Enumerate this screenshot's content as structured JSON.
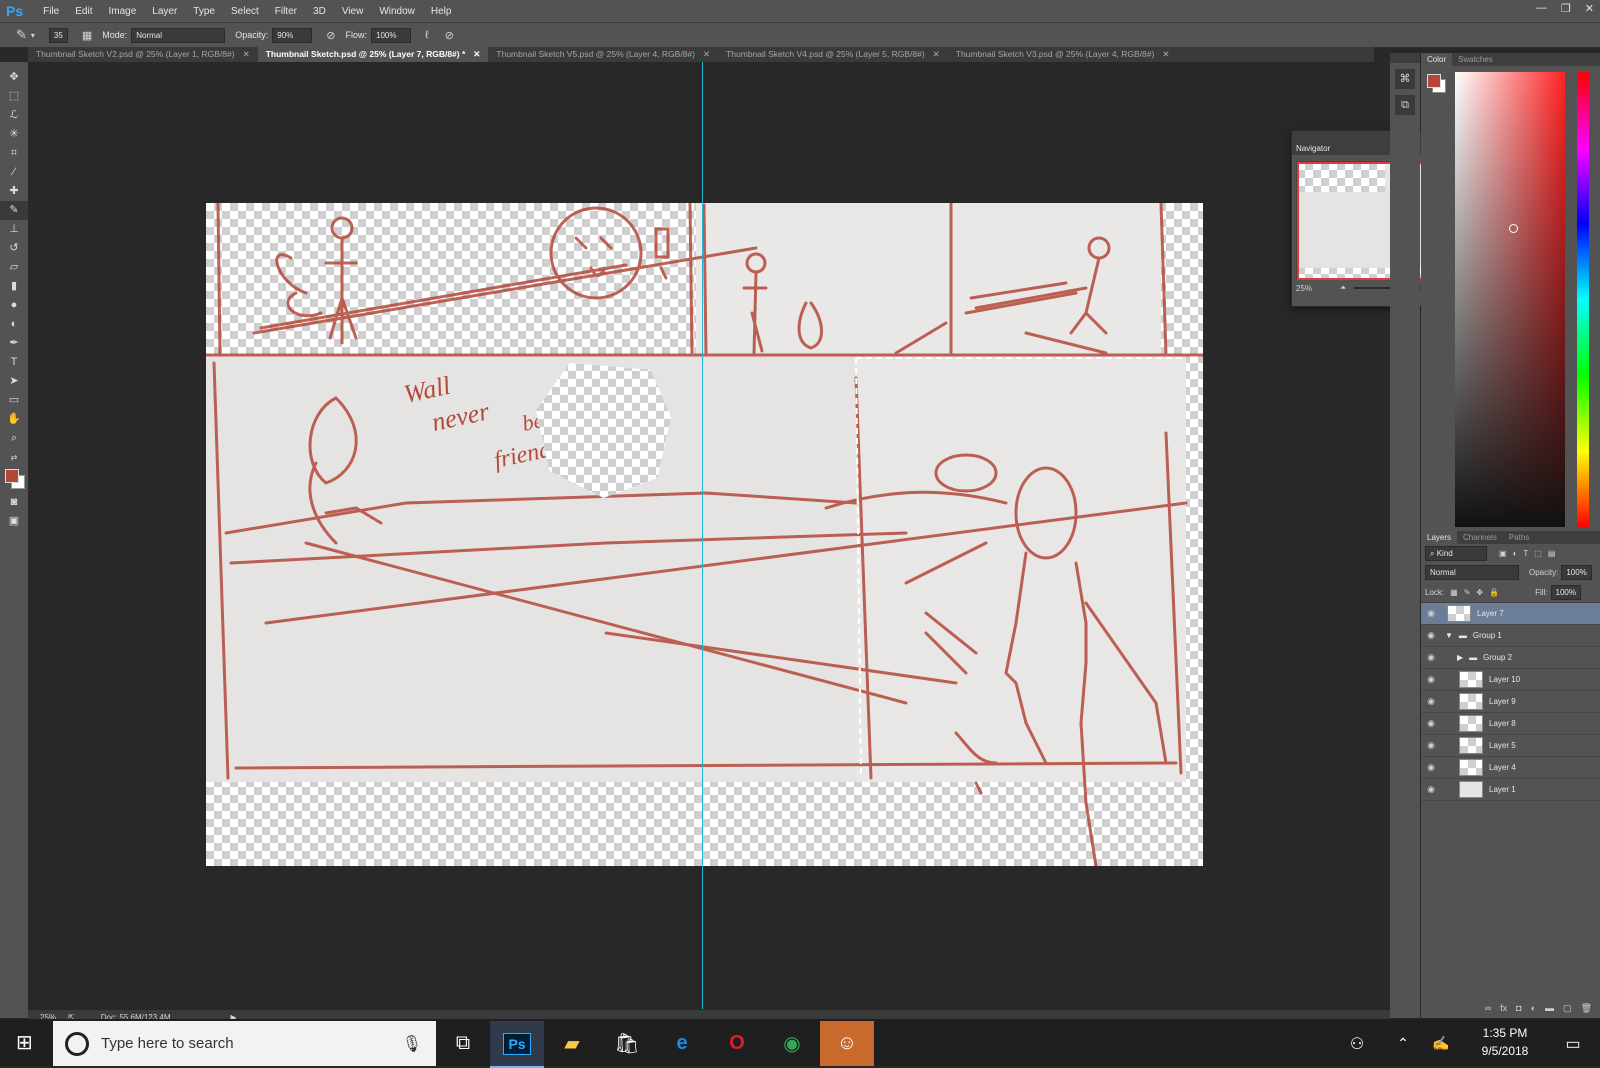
{
  "app": {
    "logo": "Ps"
  },
  "menu": [
    "File",
    "Edit",
    "Image",
    "Layer",
    "Type",
    "Select",
    "Filter",
    "3D",
    "View",
    "Window",
    "Help"
  ],
  "window_controls": {
    "minimize": "—",
    "restore": "❐",
    "close": "✕"
  },
  "options": {
    "brush_size": "35",
    "mode_label": "Mode:",
    "mode_value": "Normal",
    "opacity_label": "Opacity:",
    "opacity_value": "90%",
    "flow_label": "Flow:",
    "flow_value": "100%"
  },
  "tabs": [
    {
      "label": "Thumbnail Sketch V2.psd @ 25% (Layer 1, RGB/8#)"
    },
    {
      "label": "Thumbnail Sketch.psd @ 25% (Layer 7, RGB/8#) *"
    },
    {
      "label": "Thumbnail Sketch V5.psd @ 25% (Layer 4, RGB/8#)"
    },
    {
      "label": "Thumbnail Sketch V4.psd @ 25% (Layer 5, RGB/8#)"
    },
    {
      "label": "Thumbnail Sketch V3.psd @ 25% (Layer 4, RGB/8#)"
    }
  ],
  "tools": [
    "move-tool",
    "marquee-tool",
    "lasso-tool",
    "magic-wand-tool",
    "crop-tool",
    "eyedropper-tool",
    "healing-brush-tool",
    "brush-tool",
    "clone-stamp-tool",
    "history-brush-tool",
    "eraser-tool",
    "gradient-tool",
    "blur-tool",
    "dodge-tool",
    "pen-tool",
    "type-tool",
    "path-selection-tool",
    "rectangle-tool",
    "hand-tool",
    "zoom-tool"
  ],
  "canvas": {
    "sketch_text_1": "Wall",
    "sketch_text_2": "never",
    "sketch_text_3": "be",
    "sketch_text_4": "friends"
  },
  "navigator": {
    "title": "Navigator",
    "zoom": "25%"
  },
  "color_panel": {
    "tabs": [
      "Color",
      "Swatches"
    ],
    "foreground": "#b5473a",
    "background": "#ffffff"
  },
  "layers_panel": {
    "tabs": [
      "Layers",
      "Channels",
      "Paths"
    ],
    "filter_label": "Kind",
    "blend_mode": "Normal",
    "opacity_label": "Opacity:",
    "opacity_value": "100%",
    "lock_label": "Lock:",
    "fill_label": "Fill:",
    "fill_value": "100%",
    "layers": [
      {
        "name": "Layer 7",
        "selected": true
      },
      {
        "name": "Group 1"
      },
      {
        "name": "Group 2"
      },
      {
        "name": "Layer 10"
      },
      {
        "name": "Layer 9"
      },
      {
        "name": "Layer 8"
      },
      {
        "name": "Layer 5"
      },
      {
        "name": "Layer 4"
      },
      {
        "name": "Layer 1"
      }
    ],
    "footer_icons": [
      "link-icon",
      "fx-icon",
      "mask-icon",
      "adjustment-icon",
      "folder-icon",
      "new-layer-icon",
      "trash-icon"
    ]
  },
  "status": {
    "zoom": "25%",
    "doc": "Doc: 55.6M/123.4M"
  },
  "taskbar": {
    "search_placeholder": "Type here to search",
    "time": "1:35 PM",
    "date": "9/5/2018",
    "ps_label": "Ps"
  }
}
